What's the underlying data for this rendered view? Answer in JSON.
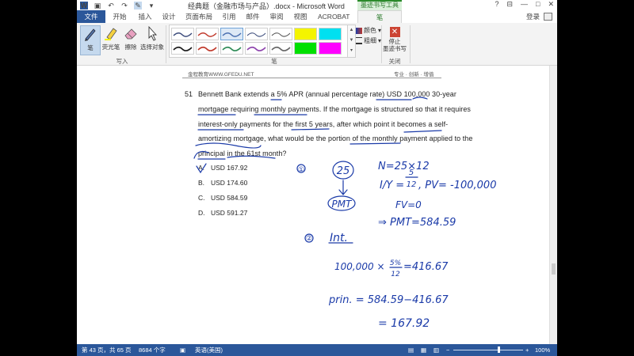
{
  "titlebar": {
    "document_title": "经典题（金融市场与产品）.docx - Microsoft Word",
    "context_tab_title": "墨迹书写工具",
    "qat_word": "W",
    "qat_save": "▣",
    "qat_undo": "↶",
    "qat_redo": "↷",
    "qat_pen": "✎",
    "qat_more": "▾",
    "help": "?",
    "ribbon_toggle": "⊟",
    "minimize": "—",
    "maximize": "□",
    "close": "✕"
  },
  "tabs": [
    {
      "label": "文件"
    },
    {
      "label": "开始"
    },
    {
      "label": "插入"
    },
    {
      "label": "设计"
    },
    {
      "label": "页面布局"
    },
    {
      "label": "引用"
    },
    {
      "label": "邮件"
    },
    {
      "label": "审阅"
    },
    {
      "label": "视图"
    },
    {
      "label": "ACROBAT"
    },
    {
      "label": "笔"
    }
  ],
  "login": "登录",
  "ribbon": {
    "pen_label": "笔",
    "highlighter_label": "荧光笔",
    "eraser_label": "擦除",
    "select_label": "选择对象",
    "group_write": "写入",
    "group_pens": "笔",
    "color_label": "颜色",
    "weight_label": "粗细",
    "stop_label": "停止\n墨迹书写",
    "group_close": "关闭",
    "pen_swatches": [
      "#3a4a7a",
      "#c0392b",
      "#4a6fb0",
      "#3a4a7a",
      "#555555",
      "#f4f400",
      "#00e0f0",
      "#1a1a1a",
      "#c0392b",
      "#2e8b57",
      "#8e44ad",
      "#666666",
      "#00e000",
      "#ff00ff"
    ]
  },
  "document": {
    "header_left": "金程教育WWW.GFEDU.NET",
    "header_right": "专业 · 创新 · 增值",
    "question_number": "51",
    "question_lines": [
      "Bennett Bank extends a 5% APR (annual percentage rate) USD 100,000 30-year",
      "mortgage requiring monthly payments. If the mortgage is structured so that it requires",
      "interest-only payments for the first 5 years, after which point it becomes a self-",
      "amortizing mortgage, what would be the portion of the monthly payment applied to the",
      "principal in the 61st month?"
    ],
    "options": [
      {
        "letter": "A.",
        "value": "USD 167.92"
      },
      {
        "letter": "B.",
        "value": "USD 174.60"
      },
      {
        "letter": "C.",
        "value": "USD 584.59"
      },
      {
        "letter": "D.",
        "value": "USD 591.27"
      }
    ]
  },
  "handwriting": {
    "step1_mark": "①",
    "step1_circle_text": "25",
    "step1_pmt": "PMT",
    "step1_n": "N=25×12",
    "step1_iy_left": "I/Y =",
    "step1_iy_num": "5",
    "step1_iy_den": "12",
    "step1_pv": ", PV= -100,000",
    "step1_fv": "FV=0",
    "step1_result": "⇒ PMT=584.59",
    "step2_mark": "②",
    "step2_title": "Int.",
    "step2_calc_left": "100,000 ×",
    "step2_calc_num": "5%",
    "step2_calc_den": "12",
    "step2_calc_right": "=416.67",
    "step2_prin": "prin. = 584.59−416.67",
    "step2_answer": "= 167.92",
    "ink_color": "#1a3aa8"
  },
  "statusbar": {
    "page": "第 43 页，共 65 页",
    "words": "8684 个字",
    "language": "英语(美国)",
    "zoom": "100%",
    "zoom_minus": "−",
    "zoom_plus": "+"
  }
}
